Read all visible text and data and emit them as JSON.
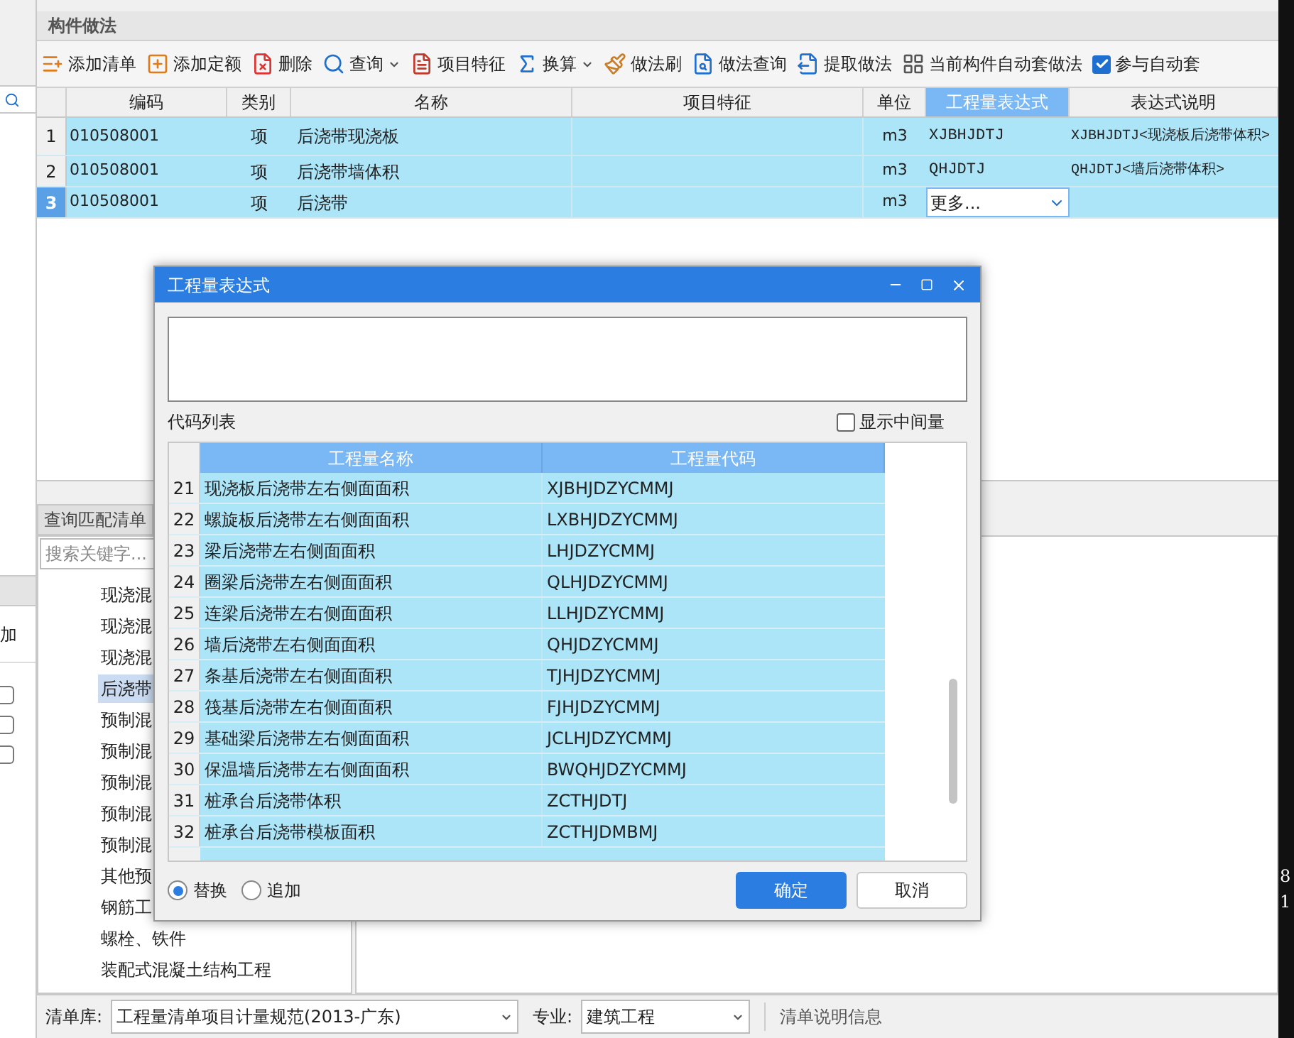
{
  "left_panel": {
    "column_header": "加",
    "checkboxes": [
      {
        "checked": false
      },
      {
        "checked": false
      },
      {
        "checked": false
      }
    ]
  },
  "method_panel": {
    "title": "构件做法",
    "toolbar": [
      {
        "label": "添加清单",
        "dropdown": false
      },
      {
        "label": "添加定额",
        "dropdown": false
      },
      {
        "label": "删除",
        "dropdown": false
      },
      {
        "label": "查询",
        "dropdown": true
      },
      {
        "label": "项目特征",
        "dropdown": false
      },
      {
        "label": "换算",
        "dropdown": true
      },
      {
        "label": "做法刷",
        "dropdown": false
      },
      {
        "label": "做法查询",
        "dropdown": false
      },
      {
        "label": "提取做法",
        "dropdown": false
      },
      {
        "label": "当前构件自动套做法",
        "dropdown": false
      }
    ],
    "auto_apply": {
      "label": "参与自动套",
      "checked": true
    },
    "table": {
      "columns": [
        {
          "label": "编码",
          "selected": false
        },
        {
          "label": "类别",
          "selected": false
        },
        {
          "label": "名称",
          "selected": false
        },
        {
          "label": "项目特征",
          "selected": false
        },
        {
          "label": "单位",
          "selected": false
        },
        {
          "label": "工程量表达式",
          "selected": true
        },
        {
          "label": "表达式说明",
          "selected": false
        }
      ],
      "rows": [
        {
          "index": "1",
          "code": "010508001",
          "category": "项",
          "name": "后浇带现浇板",
          "feature": "",
          "unit": "m3",
          "expression": "XJBHJDTJ",
          "description": "XJBHJDTJ<现浇板后浇带体积>",
          "selected": false,
          "editing": false
        },
        {
          "index": "2",
          "code": "010508001",
          "category": "项",
          "name": "后浇带墙体积",
          "feature": "",
          "unit": "m3",
          "expression": "QHJDTJ",
          "description": "QHJDTJ<墙后浇带体积>",
          "selected": false,
          "editing": false
        },
        {
          "index": "3",
          "code": "010508001",
          "category": "项",
          "name": "后浇带",
          "feature": "",
          "unit": "m3",
          "expression": "更多...",
          "description": "",
          "selected": true,
          "editing": true
        }
      ]
    }
  },
  "query_panel": {
    "tab": "查询匹配清单",
    "search": {
      "placeholder": "搜索关键字..."
    },
    "tree": [
      {
        "label": "现浇混",
        "selected": false
      },
      {
        "label": "现浇混",
        "selected": false
      },
      {
        "label": "现浇混",
        "selected": false
      },
      {
        "label": "后浇带",
        "selected": true
      },
      {
        "label": "预制混",
        "selected": false
      },
      {
        "label": "预制混",
        "selected": false
      },
      {
        "label": "预制混",
        "selected": false
      },
      {
        "label": "预制混",
        "selected": false
      },
      {
        "label": "预制混",
        "selected": false
      },
      {
        "label": "其他预",
        "selected": false
      },
      {
        "label": "钢筋工",
        "selected": false
      },
      {
        "label": "螺栓、铁件",
        "selected": false
      },
      {
        "label": "装配式混凝土结构工程",
        "selected": false
      }
    ]
  },
  "status_bar": {
    "library_label": "清单库:",
    "library_value": "工程量清单项目计量规范(2013-广东)",
    "specialty_label": "专业:",
    "specialty_value": "建筑工程",
    "info": "清单说明信息"
  },
  "canvas_labels": [
    "8",
    "1"
  ],
  "dialog": {
    "title": "工程量表达式",
    "list_label": "代码列表",
    "show_intermediate": {
      "label": "显示中间量",
      "checked": false
    },
    "columns": [
      "工程量名称",
      "工程量代码"
    ],
    "rows": [
      {
        "index": "21",
        "name": "现浇板后浇带左右侧面面积",
        "code": "XJBHJDZYCMMJ"
      },
      {
        "index": "22",
        "name": "螺旋板后浇带左右侧面面积",
        "code": "LXBHJDZYCMMJ"
      },
      {
        "index": "23",
        "name": "梁后浇带左右侧面面积",
        "code": "LHJDZYCMMJ"
      },
      {
        "index": "24",
        "name": "圈梁后浇带左右侧面面积",
        "code": "QLHJDZYCMMJ"
      },
      {
        "index": "25",
        "name": "连梁后浇带左右侧面面积",
        "code": "LLHJDZYCMMJ"
      },
      {
        "index": "26",
        "name": "墙后浇带左右侧面面积",
        "code": "QHJDZYCMMJ"
      },
      {
        "index": "27",
        "name": "条基后浇带左右侧面面积",
        "code": "TJHJDZYCMMJ"
      },
      {
        "index": "28",
        "name": "筏基后浇带左右侧面面积",
        "code": "FJHJDZYCMMJ"
      },
      {
        "index": "29",
        "name": "基础梁后浇带左右侧面面积",
        "code": "JCLHJDZYCMMJ"
      },
      {
        "index": "30",
        "name": "保温墙后浇带左右侧面面积",
        "code": "BWQHJDZYCMMJ"
      },
      {
        "index": "31",
        "name": "桩承台后浇带体积",
        "code": "ZCTHJDTJ"
      },
      {
        "index": "32",
        "name": "桩承台后浇带模板面积",
        "code": "ZCTHJDMBMJ"
      }
    ],
    "modes": [
      {
        "label": "替换",
        "selected": true
      },
      {
        "label": "追加",
        "selected": false
      }
    ],
    "buttons": [
      {
        "label": "确定",
        "kind": "primary"
      },
      {
        "label": "取消",
        "kind": "secondary"
      }
    ]
  }
}
